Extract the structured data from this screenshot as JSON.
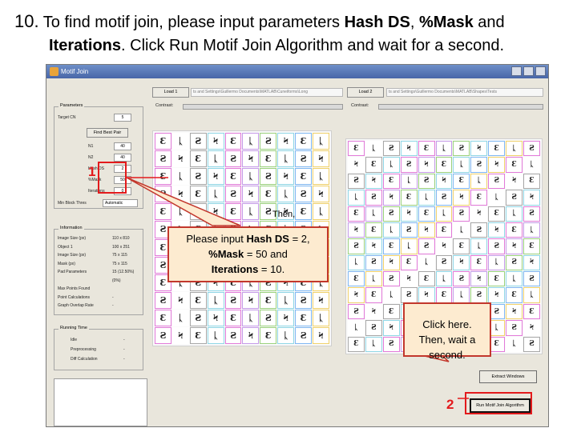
{
  "heading": {
    "number": "10.",
    "line1_pre": "To find motif join, please input parameters ",
    "bold_hash": "Hash DS",
    "comma": ", ",
    "bold_mask": "%Mask",
    "line1_post": " and",
    "bold_iterations": "Iterations",
    "line2_post": ". Click Run Motif Join Algorithm and wait for a second."
  },
  "window": {
    "title": "Motif Join",
    "buttons": {
      "load1": "Load 1",
      "load2": "Load 2",
      "extract": "Extract Windows",
      "run": "Run Motif Join Algorithm"
    },
    "path1": "ts and Settings\\Guillermo Documents\\MATLAB\\Cuneiforms\\Long",
    "path2": "ts and Settings\\Guillermo Documents\\MATLAB\\Shapes\\Tests",
    "contrast_label": "Contrast:",
    "parameters": {
      "title": "Parameters",
      "target_label": "Target CN",
      "target_value": "5",
      "find_button": "Find Best Pair",
      "rows": [
        {
          "label": "N1",
          "value": "40"
        },
        {
          "label": "N2",
          "value": "40"
        },
        {
          "label": "Hash DS",
          "value": "2"
        },
        {
          "label": "%Mask",
          "value": "50"
        },
        {
          "label": "Iterations",
          "value": "0"
        }
      ],
      "block_label": "Min Block Thres",
      "block_value": "Automatic"
    },
    "information": {
      "title": "Information",
      "rows": [
        {
          "label": "Image Size (px)",
          "value": "110 x 810"
        },
        {
          "label": "Object 1",
          "value": "100 x 251"
        },
        {
          "label": "Image Size (px)",
          "value": "75 x 115"
        },
        {
          "label": "Mask (px)",
          "value": "75 x 115"
        },
        {
          "label": "Pad Parameters",
          "value": "15 (12.50%)"
        },
        {
          "label": "",
          "value": "(0%)"
        },
        {
          "label": "Max Points Found",
          "value": ""
        },
        {
          "label": "Point Calculations",
          "value": "-"
        },
        {
          "label": "Graph Overlap Rate",
          "value": "-"
        }
      ]
    },
    "running_time": {
      "title": "Running Time",
      "rows": [
        {
          "label": "Idle",
          "value": "-"
        },
        {
          "label": "Preprocessing",
          "value": "-"
        },
        {
          "label": "Diff Calculation",
          "value": "-"
        }
      ]
    }
  },
  "callouts": {
    "c1_bold_hash": "Hash DS",
    "c1_text1": "Please input ",
    "c1_text2": " = 2,",
    "c1_bold_mask": "%Mask",
    "c1_text3": " = 50 and",
    "c1_bold_iter": "Iterations",
    "c1_text4": " = 10.",
    "c2": "Click here. Then, wait a second.",
    "then": "Then,",
    "marker1": "1",
    "marker2": "2"
  },
  "colors": {
    "callout_fill": "#fdebd0",
    "callout_border": "#c2372c",
    "marker": "#e31a1c"
  }
}
